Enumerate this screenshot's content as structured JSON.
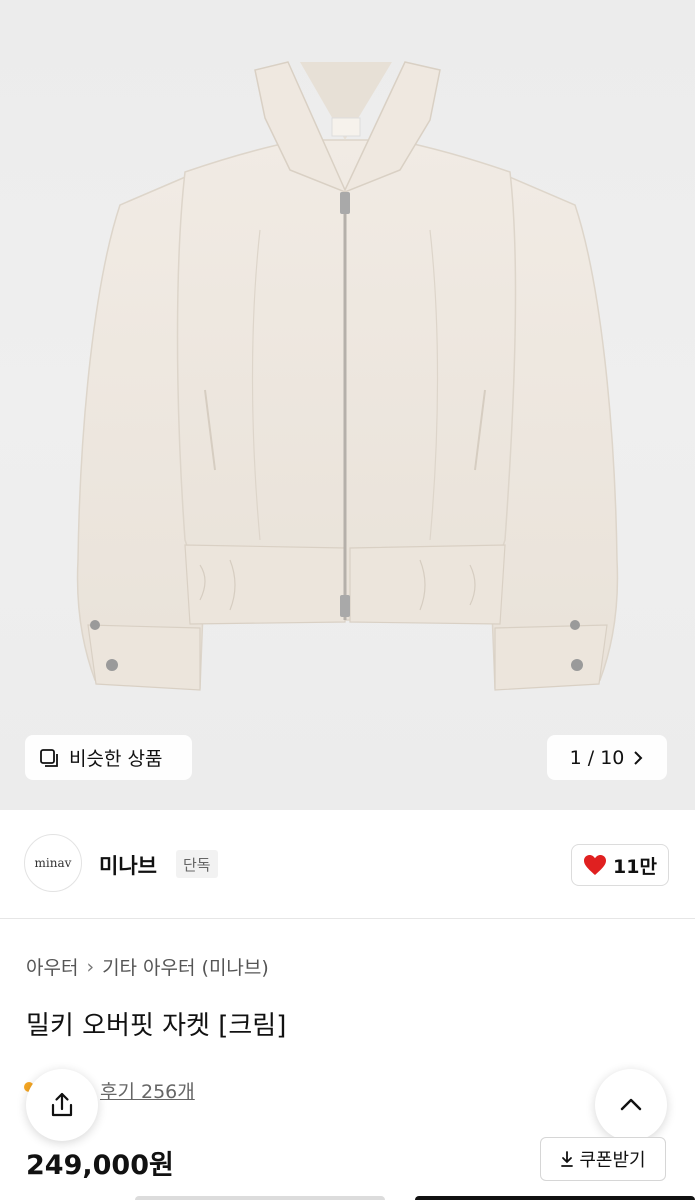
{
  "gallery": {
    "similar_label": "비슷한 상품",
    "counter": "1 / 10",
    "icons": {
      "similar": "similar-items-icon",
      "next": "chevron-right-icon"
    }
  },
  "seller": {
    "logo_text": "minav",
    "name": "미나브",
    "badge": "단독",
    "like_count": "11만",
    "like_color": "#e02020"
  },
  "product": {
    "breadcrumb": [
      "아우터",
      "기타 아우터 (미나브)"
    ],
    "title": "밀키 오버핏 자켓 [크림]",
    "review_text": "후기 256개",
    "price": "249,000원",
    "coupon_label": "쿠폰받기"
  },
  "icons": {
    "share": "share-icon",
    "scroll_top": "chevron-up-icon",
    "coupon": "download-icon",
    "like": "heart-icon"
  }
}
